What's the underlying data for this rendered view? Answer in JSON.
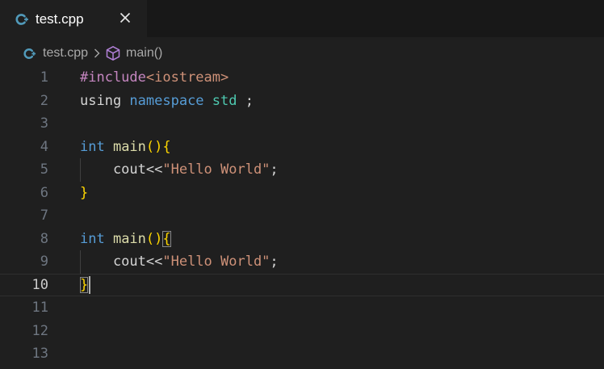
{
  "tab": {
    "label": "test.cpp",
    "icon": "cpp-file-icon",
    "close_icon": "close-icon"
  },
  "breadcrumb": {
    "file": "test.cpp",
    "symbol": "main()",
    "symbol_icon": "cube-icon",
    "separator_icon": "chevron-right-icon"
  },
  "colors": {
    "background": "#1f1f1f",
    "tabbar": "#181818",
    "keyword": "#569cd6",
    "preprocessor": "#c586c0",
    "string": "#ce9178",
    "function": "#dcdcaa",
    "namespace": "#4ec9b0",
    "bracket": "#ffd700",
    "cpp_icon": "#519aba"
  },
  "editor": {
    "current_line": 10,
    "lines": [
      {
        "n": "1",
        "t": [
          {
            "c": "pp",
            "v": "#include"
          },
          {
            "c": "inc",
            "v": "<iostream>"
          }
        ]
      },
      {
        "n": "2",
        "t": [
          {
            "c": "plain",
            "v": "using "
          },
          {
            "c": "kw",
            "v": "namespace "
          },
          {
            "c": "ns",
            "v": "std"
          },
          {
            "c": "plain",
            "v": " ;"
          }
        ]
      },
      {
        "n": "3",
        "t": []
      },
      {
        "n": "4",
        "t": [
          {
            "c": "kw",
            "v": "int "
          },
          {
            "c": "fn",
            "v": "main"
          },
          {
            "c": "br",
            "v": "(){"
          }
        ]
      },
      {
        "n": "5",
        "t": [
          {
            "c": "plain",
            "v": "    cout<<"
          },
          {
            "c": "str",
            "v": "\"Hello World\""
          },
          {
            "c": "plain",
            "v": ";"
          }
        ]
      },
      {
        "n": "6",
        "t": [
          {
            "c": "br",
            "v": "}"
          }
        ]
      },
      {
        "n": "7",
        "t": []
      },
      {
        "n": "8",
        "t": [
          {
            "c": "kw",
            "v": "int "
          },
          {
            "c": "fn",
            "v": "main"
          },
          {
            "c": "br",
            "v": "()"
          },
          {
            "c": "brbox",
            "v": "{"
          }
        ]
      },
      {
        "n": "9",
        "t": [
          {
            "c": "plain",
            "v": "    cout<<"
          },
          {
            "c": "str",
            "v": "\"Hello World\""
          },
          {
            "c": "plain",
            "v": ";"
          }
        ]
      },
      {
        "n": "10",
        "t": [
          {
            "c": "brbox",
            "v": "}"
          }
        ]
      },
      {
        "n": "11",
        "t": []
      },
      {
        "n": "12",
        "t": []
      },
      {
        "n": "13",
        "t": []
      }
    ]
  }
}
